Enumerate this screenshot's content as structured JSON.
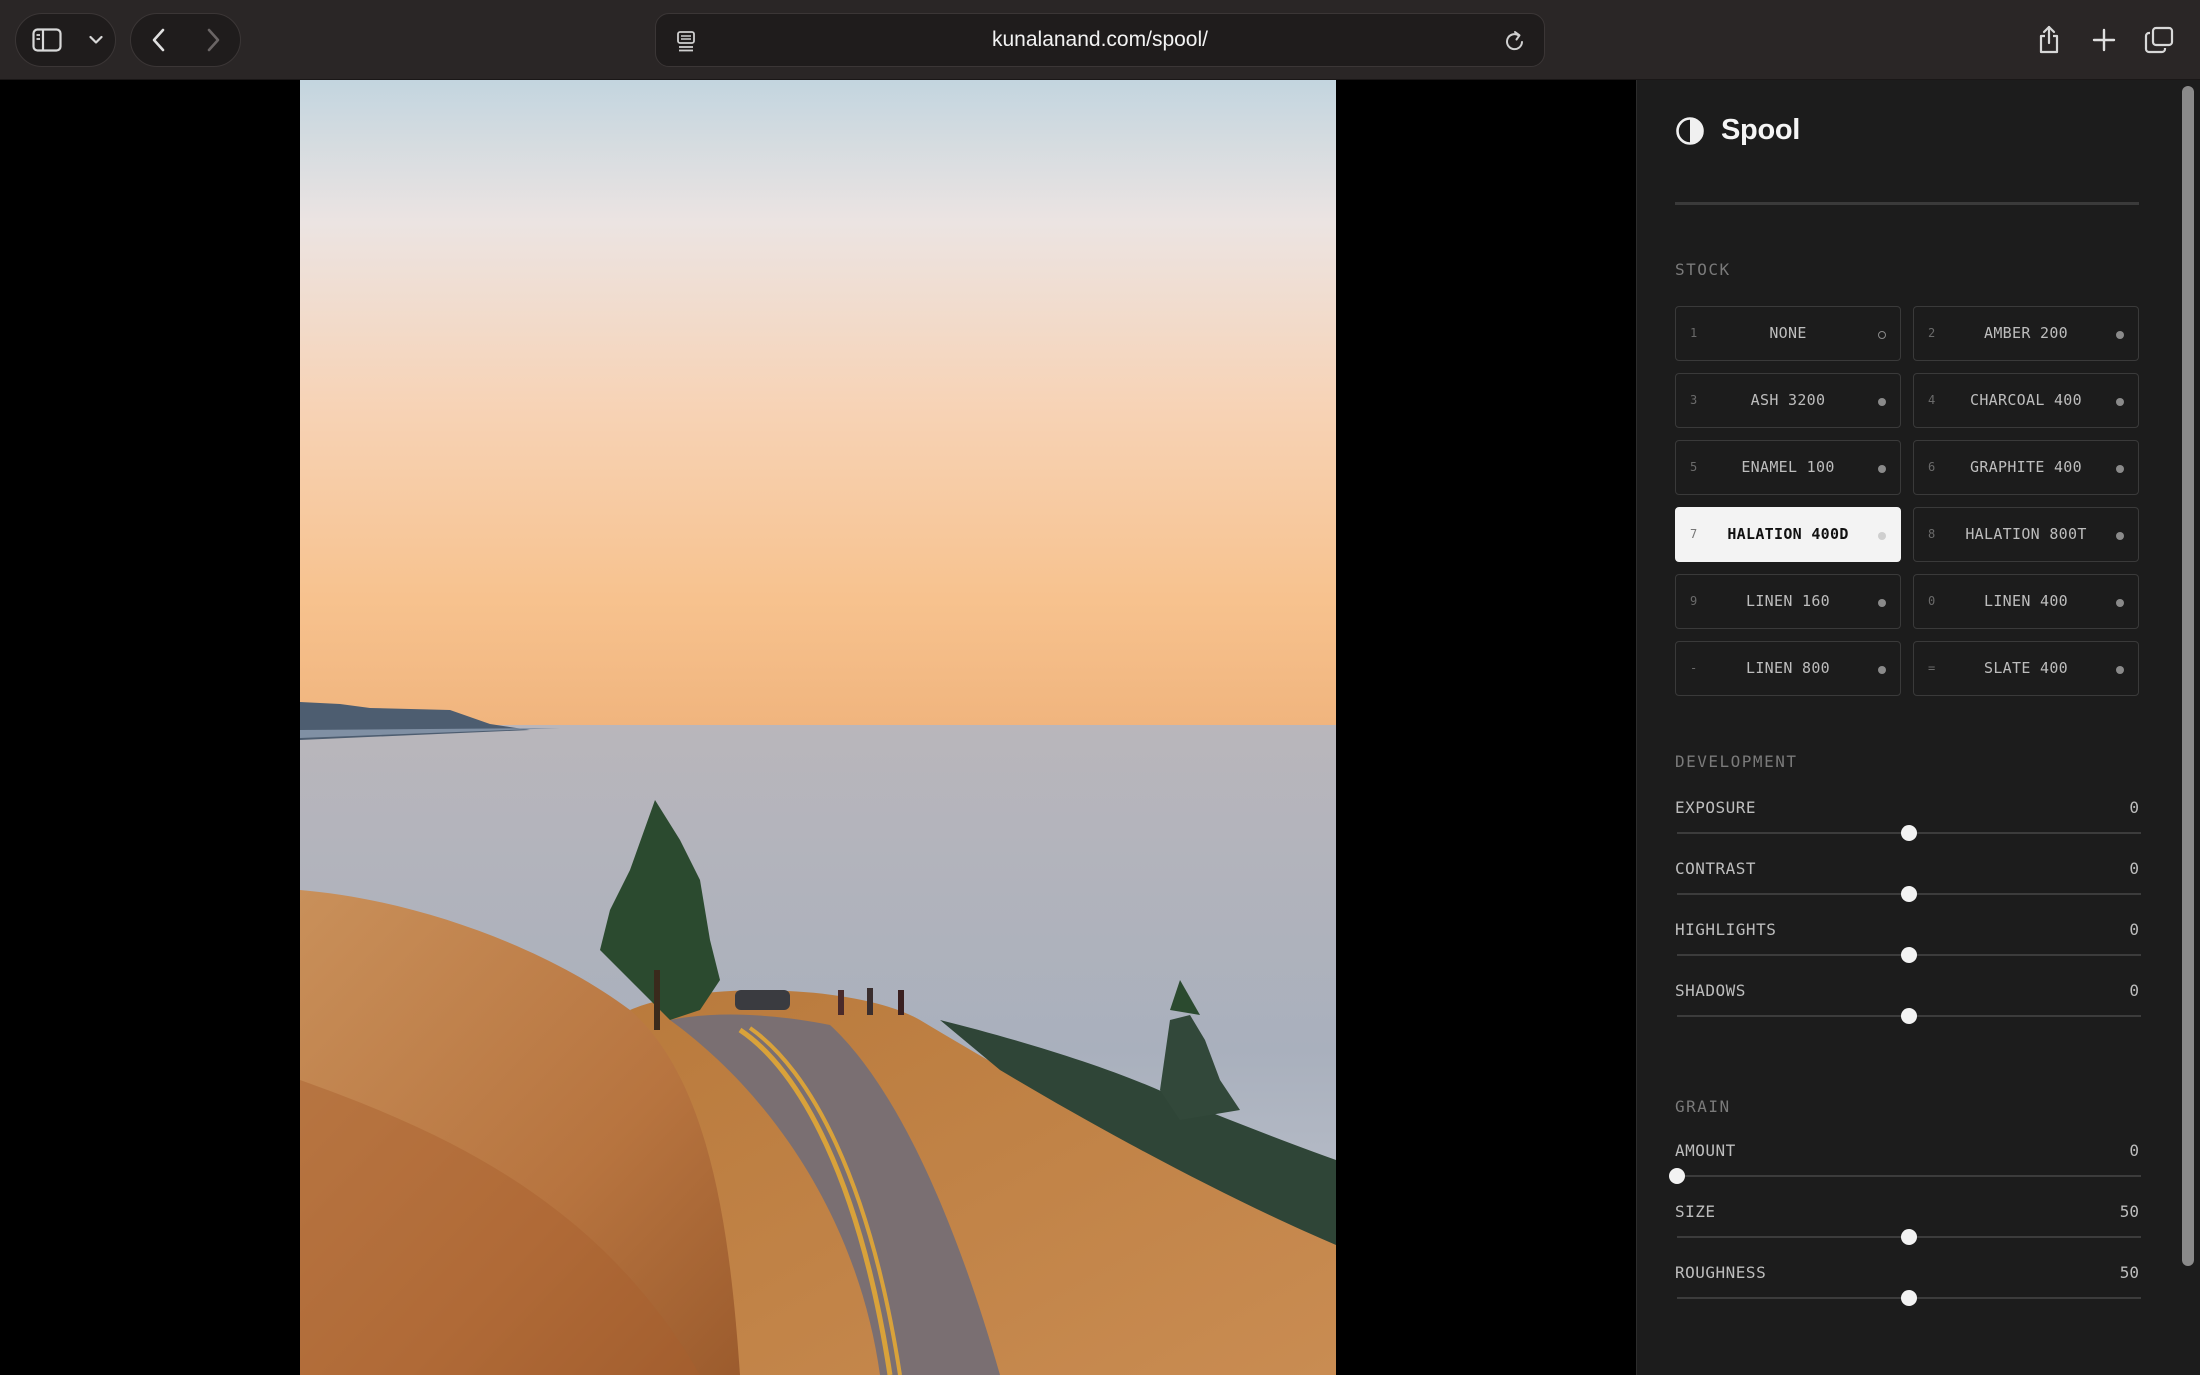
{
  "browser": {
    "url": "kunalanand.com/spool/",
    "icons": [
      "sidebar-icon",
      "chevron-down-icon",
      "back-icon",
      "forward-icon",
      "page-icon",
      "reload-icon",
      "share-icon",
      "plus-icon",
      "tabs-icon"
    ]
  },
  "sidebar": {
    "title": "Spool",
    "logo_icon": "half-circle-icon",
    "stock": {
      "label": "STOCK",
      "items": [
        {
          "key": "1",
          "name": "NONE",
          "dot": "hollow",
          "active": false
        },
        {
          "key": "2",
          "name": "AMBER 200",
          "dot": "filled",
          "active": false
        },
        {
          "key": "3",
          "name": "ASH 3200",
          "dot": "filled",
          "active": false
        },
        {
          "key": "4",
          "name": "CHARCOAL 400",
          "dot": "filled",
          "active": false
        },
        {
          "key": "5",
          "name": "ENAMEL 100",
          "dot": "filled",
          "active": false
        },
        {
          "key": "6",
          "name": "GRAPHITE 400",
          "dot": "filled",
          "active": false
        },
        {
          "key": "7",
          "name": "HALATION 400D",
          "dot": "filled",
          "active": true
        },
        {
          "key": "8",
          "name": "HALATION 800T",
          "dot": "filled",
          "active": false
        },
        {
          "key": "9",
          "name": "LINEN 160",
          "dot": "filled",
          "active": false
        },
        {
          "key": "0",
          "name": "LINEN 400",
          "dot": "filled",
          "active": false
        },
        {
          "key": "-",
          "name": "LINEN 800",
          "dot": "filled",
          "active": false
        },
        {
          "key": "=",
          "name": "SLATE 400",
          "dot": "filled",
          "active": false
        }
      ]
    },
    "development": {
      "label": "DEVELOPMENT",
      "sliders": [
        {
          "label": "EXPOSURE",
          "value": "0",
          "position": 0.5
        },
        {
          "label": "CONTRAST",
          "value": "0",
          "position": 0.5
        },
        {
          "label": "HIGHLIGHTS",
          "value": "0",
          "position": 0.5
        },
        {
          "label": "SHADOWS",
          "value": "0",
          "position": 0.5
        }
      ]
    },
    "grain": {
      "label": "GRAIN",
      "sliders": [
        {
          "label": "AMOUNT",
          "value": "0",
          "position": 0.0
        },
        {
          "label": "SIZE",
          "value": "50",
          "position": 0.5
        },
        {
          "label": "ROUGHNESS",
          "value": "50",
          "position": 0.5
        }
      ]
    }
  },
  "colors": {
    "chrome_bg": "#2a2626",
    "sidebar_bg": "#1c1c1c",
    "active_stock_bg": "#f3f3f3",
    "text_muted": "#7a7a7a"
  }
}
